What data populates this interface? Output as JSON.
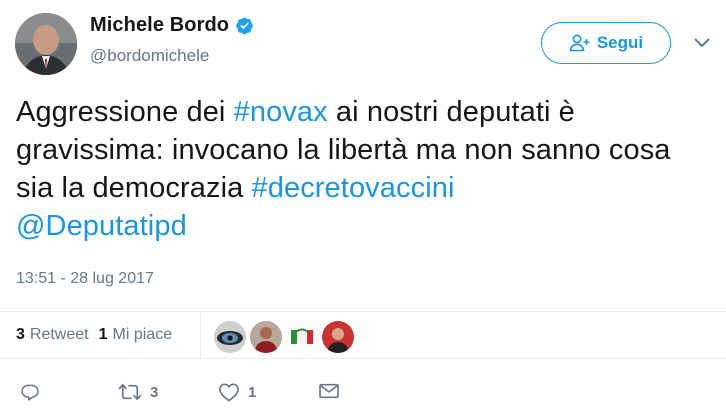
{
  "author": {
    "name": "Michele Bordo",
    "handle": "@bordomichele",
    "verified_color": "#1da1f2"
  },
  "follow_button": {
    "label": "Segui",
    "icon": "add-user-icon",
    "color": "#1b95e0"
  },
  "tweet": {
    "text_1": "Aggressione dei ",
    "hashtag_1": "#novax",
    "text_2": " ai nostri deputati è gravissima: invocano la libertà ma non sanno cosa sia la democrazia ",
    "hashtag_2": "#decretovaccini",
    "mention": "@Deputatipd",
    "timestamp": "13:51 - 28 lug 2017"
  },
  "stats": {
    "retweets_count": "3",
    "retweets_label": "Retweet",
    "likes_count": "1",
    "likes_label": "Mi piace"
  },
  "actions": {
    "reply_icon": "reply-icon",
    "retweet_icon": "retweet-icon",
    "retweet_count": "3",
    "like_icon": "heart-icon",
    "like_count": "1",
    "dm_icon": "envelope-icon"
  }
}
